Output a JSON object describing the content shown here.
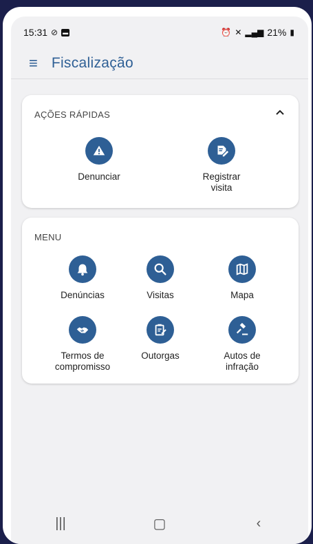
{
  "status": {
    "time": "15:31",
    "battery": "21%"
  },
  "appbar": {
    "title": "Fiscalização"
  },
  "quick_actions": {
    "title": "AÇÕES RÁPIDAS",
    "items": [
      {
        "label": "Denunciar",
        "icon": "warning-icon"
      },
      {
        "label": "Registrar\nvisita",
        "icon": "edit-document-icon"
      }
    ]
  },
  "menu": {
    "title": "MENU",
    "items": [
      {
        "label": "Denúncias",
        "icon": "bell-icon"
      },
      {
        "label": "Visitas",
        "icon": "search-icon"
      },
      {
        "label": "Mapa",
        "icon": "map-icon"
      },
      {
        "label": "Termos de\ncompromisso",
        "icon": "handshake-icon"
      },
      {
        "label": "Outorgas",
        "icon": "clipboard-icon"
      },
      {
        "label": "Autos de\ninfração",
        "icon": "gavel-icon"
      }
    ]
  },
  "colors": {
    "accent": "#2e5f95",
    "background": "#f1f1f3",
    "frame": "#1b1f4b"
  }
}
